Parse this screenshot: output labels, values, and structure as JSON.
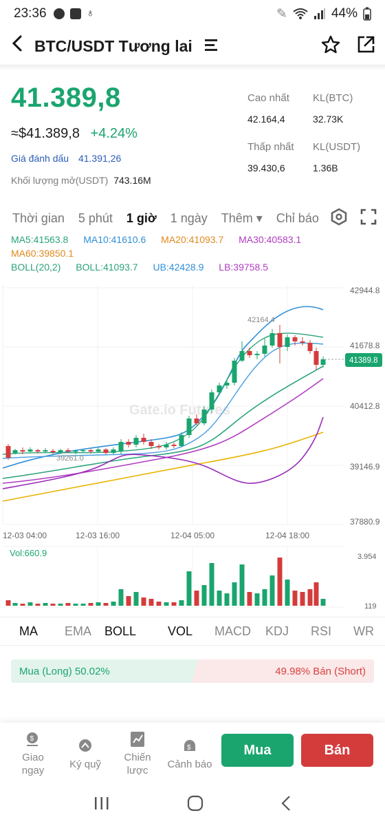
{
  "status_bar": {
    "time": "23:36",
    "battery": "44%"
  },
  "header": {
    "title": "BTC/USDT Tương lai"
  },
  "price": {
    "last": "41.389,8",
    "usd": "≈$41.389,8",
    "change": "+4.24%",
    "mark_label": "Giá đánh dấu",
    "mark_value": "41.391,26",
    "oi_label": "Khối lượng mở(USDT)",
    "oi_value": "743.16M"
  },
  "stats": {
    "high_label": "Cao nhất",
    "high_value": "42.164,4",
    "vol_btc_label": "KL(BTC)",
    "vol_btc_value": "32.73K",
    "low_label": "Thấp nhất",
    "low_value": "39.430,6",
    "vol_usdt_label": "KL(USDT)",
    "vol_usdt_value": "1.36B"
  },
  "timeframes": [
    {
      "label": "Thời gian",
      "active": false
    },
    {
      "label": "5 phút",
      "active": false
    },
    {
      "label": "1 giờ",
      "active": true
    },
    {
      "label": "1 ngày",
      "active": false
    },
    {
      "label": "Thêm ▾",
      "active": false
    },
    {
      "label": "Chỉ báo",
      "active": false
    }
  ],
  "indicators_line1": [
    {
      "text": "MA5:41563.8",
      "color": "#2aa37a"
    },
    {
      "text": "MA10:41610.6",
      "color": "#2f8fd8"
    },
    {
      "text": "MA20:41093.7",
      "color": "#e08a1e"
    },
    {
      "text": "MA30:40583.1",
      "color": "#b03cc0"
    }
  ],
  "indicators_line2": [
    {
      "text": "MA60:39850.1",
      "color": "#e08a1e"
    }
  ],
  "indicators_line3": [
    {
      "text": "BOLL(20,2)",
      "color": "#2aa37a"
    },
    {
      "text": "BOLL:41093.7",
      "color": "#2aa37a"
    },
    {
      "text": "UB:42428.9",
      "color": "#2f8fd8"
    },
    {
      "text": "LB:39758.5",
      "color": "#b03cc0"
    }
  ],
  "chart": {
    "y_ticks": [
      "42944.8",
      "41678.8",
      "40412.8",
      "39146.9",
      "37880.9"
    ],
    "x_ticks": [
      "12-03 04:00",
      "12-03 16:00",
      "12-04 05:00",
      "12-04 18:00"
    ],
    "high_marker": "42164.4",
    "low_marker": "39261.0",
    "current_price_tag": "41389.8",
    "volume_label": "Vol:660.9",
    "vol_max": "3.954",
    "vol_min": "119",
    "watermark": "Gate.io Futures"
  },
  "indicator_tabs": [
    {
      "label": "MA",
      "active": true
    },
    {
      "label": "EMA",
      "active": false
    },
    {
      "label": "BOLL",
      "active": true
    },
    {
      "label": "VOL",
      "active": true
    },
    {
      "label": "MACD",
      "active": false
    },
    {
      "label": "KDJ",
      "active": false
    },
    {
      "label": "RSI",
      "active": false
    },
    {
      "label": "WR",
      "active": false
    }
  ],
  "ratio": {
    "long": "Mua (Long) 50.02%",
    "short": "49.98% Bán (Short)",
    "long_fraction": 0.5002
  },
  "bottom_nav": {
    "items": [
      {
        "label": "Giao\nngay"
      },
      {
        "label": "Ký quỹ"
      },
      {
        "label": "Chiến\nlược"
      },
      {
        "label": "Cảnh báo"
      }
    ],
    "buy": "Mua",
    "sell": "Bán"
  },
  "colors": {
    "up": "#1aa56e",
    "down": "#d43c3c"
  }
}
